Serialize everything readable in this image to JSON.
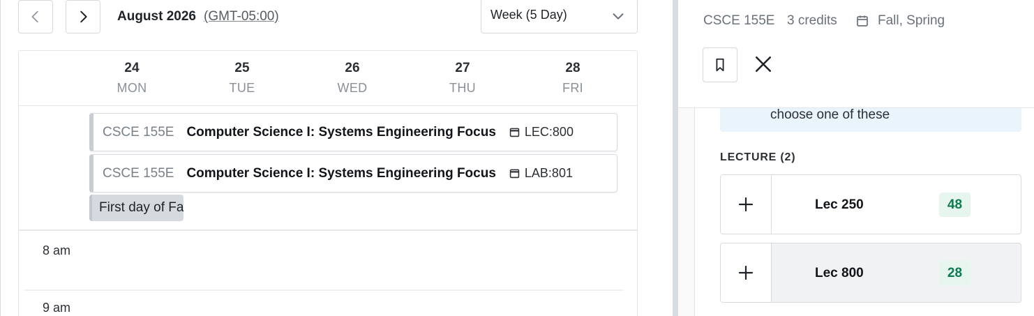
{
  "calendar": {
    "prev_label": "previous",
    "next_label": "next",
    "month": "August 2026",
    "timezone": "(GMT-05:00)",
    "view": "Week (5 Day)",
    "days": [
      {
        "num": "24",
        "name": "MON"
      },
      {
        "num": "25",
        "name": "TUE"
      },
      {
        "num": "26",
        "name": "WED"
      },
      {
        "num": "27",
        "name": "THU"
      },
      {
        "num": "28",
        "name": "FRI"
      }
    ],
    "events": [
      {
        "code": "CSCE 155E",
        "title": "Computer Science I: Systems Engineering Focus",
        "section": "LEC:800"
      },
      {
        "code": "CSCE 155E",
        "title": "Computer Science I: Systems Engineering Focus",
        "section": "LAB:801"
      }
    ],
    "all_day_event": "First day of Fa",
    "hours": [
      "8 am",
      "9 am"
    ]
  },
  "detail": {
    "course_code": "CSCE 155E",
    "credits": "3 credits",
    "terms": "Fall, Spring",
    "info_text": "choose one of these",
    "section_group_label": "LECTURE (2)",
    "sections": [
      {
        "name": "Lec 250",
        "seats": "48",
        "selected": false
      },
      {
        "name": "Lec 800",
        "seats": "28",
        "selected": true
      }
    ]
  },
  "colors": {
    "seat_badge_bg": "#e6f6ef",
    "seat_badge_text": "#0f7a4d",
    "info_box_bg": "#eaf4fd",
    "all_day_chip_bg": "#d6d9de"
  }
}
